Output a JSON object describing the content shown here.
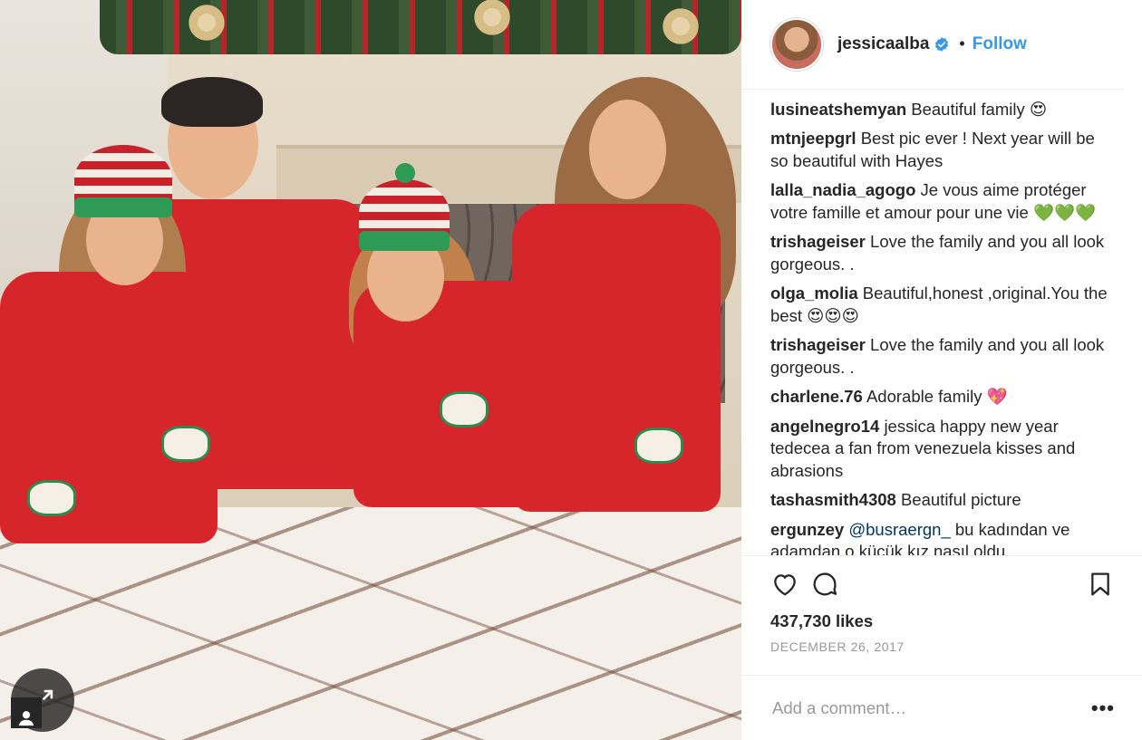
{
  "post": {
    "photo_alt": "",
    "header": {
      "username": "jessicaalba",
      "verified": true,
      "separator": "•",
      "follow_label": "Follow"
    },
    "comments": [
      {
        "user": "lusineatshemyan",
        "text": "Beautiful family 😍"
      },
      {
        "user": "mtnjeepgrl",
        "text": "Best pic ever ! Next year will be so beautiful with Hayes"
      },
      {
        "user": "lalla_nadia_agogo",
        "text": "Je vous aime protéger votre famille et amour pour une vie 💚💚💚"
      },
      {
        "user": "trishageiser",
        "text": "Love the family and you all look gorgeous. ."
      },
      {
        "user": "olga_molia",
        "text": "Beautiful,honest ,original.You the best 😍😍😍"
      },
      {
        "user": "trishageiser",
        "text": "Love the family and you all look gorgeous. ."
      },
      {
        "user": "charlene.76",
        "text": "Adorable family 💖"
      },
      {
        "user": "angelnegro14",
        "text": "jessica happy new year tedecea a fan from venezuela kisses and abrasions"
      },
      {
        "user": "tashasmith4308",
        "text": "Beautiful picture"
      },
      {
        "user": "ergunzey",
        "mention": "@busraergn_",
        "text": " bu kadından ve adamdan o küçük kız nasıl oldu"
      }
    ],
    "likes": "437,730 likes",
    "date": "DECEMBER 26, 2017",
    "add_comment_placeholder": "Add a comment…",
    "more_label": "•••",
    "icons": {
      "like": "heart-icon",
      "comment": "comment-icon",
      "save": "bookmark-icon",
      "verified": "verified-badge-icon",
      "expand": "expand-icon",
      "tag": "user-tag-icon"
    },
    "colors": {
      "follow": "#3897f0",
      "verified": "#3897f0",
      "text": "#262626",
      "muted": "#999999",
      "pajamas": "#d7262b"
    }
  }
}
